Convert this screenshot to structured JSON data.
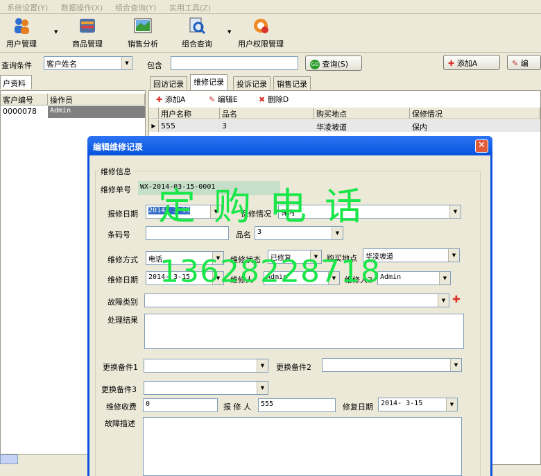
{
  "menubar": {
    "items": [
      "系统设置(Y)",
      "数据操作(X)",
      "组合查询(Y)",
      "实用工具(Z)"
    ]
  },
  "toolbar": {
    "buttons": [
      {
        "label": "用户管理",
        "icon": "users-icon"
      },
      {
        "label": "商品管理",
        "icon": "goods-icon"
      },
      {
        "label": "销售分析",
        "icon": "chart-icon"
      },
      {
        "label": "组合查询",
        "icon": "query-icon"
      },
      {
        "label": "用户权限管理",
        "icon": "permission-icon"
      }
    ]
  },
  "query": {
    "condition_label": "查询条件",
    "condition_value": "客户姓名",
    "contains_label": "包含",
    "contains_value": "",
    "search_button": "查询(S)",
    "add_button": "添加A",
    "edit_button": "编"
  },
  "left_panel": {
    "tab": "户资料",
    "columns": [
      "客户编号",
      "操作员"
    ],
    "rows": [
      [
        "0000078",
        "Admin"
      ]
    ]
  },
  "tabs": [
    "回访记录",
    "维修记录",
    "投诉记录",
    "销售记录"
  ],
  "sub_toolbar": {
    "add": "添加A",
    "edit": "编辑E",
    "delete": "删除D"
  },
  "repair_grid": {
    "columns": [
      "用户名称",
      "品名",
      "购买地点",
      "保修情况"
    ],
    "rows": [
      [
        "555",
        "3",
        "华凌坡道",
        "保内"
      ]
    ]
  },
  "dialog": {
    "title": "编辑维修记录",
    "group_title": "维修信息",
    "fields": {
      "order_no_label": "维修单号",
      "order_no": "WX-2014-03-15-0001",
      "report_date_label": "报修日期",
      "report_date": "2014- 3-15",
      "warranty_label": "保修情况",
      "warranty": "保内",
      "barcode_label": "条码号",
      "barcode": "",
      "product_label": "品名",
      "product": "3",
      "repair_mode_label": "维修方式",
      "repair_mode": "电话",
      "repair_status_label": "维修状态",
      "repair_status": "已修复",
      "purchase_place_label": "购买地点",
      "purchase_place": "华凌坡道",
      "repair_date_label": "维修日期",
      "repair_date": "2014- 3-15",
      "repairer_label": "维修人",
      "repairer": "Admin",
      "repairer2_label": "维修人2",
      "repairer2": "Admin",
      "fault_type_label": "故障类别",
      "fault_type": "",
      "result_label": "处理结果",
      "result": "",
      "part1_label": "更换备件1",
      "part1": "",
      "part2_label": "更换备件2",
      "part2": "",
      "part3_label": "更换备件3",
      "part3": "",
      "fee_label": "维修收费",
      "fee": "0",
      "reporter_label": "报 修 人",
      "reporter": "555",
      "fix_date_label": "修复日期",
      "fix_date": "2014- 3-15",
      "fault_desc_label": "故障描述",
      "fault_desc": ""
    }
  },
  "watermark": {
    "line1": "定购电话",
    "line2": "13628228718"
  },
  "colors": {
    "dialog_title": "#0753dc",
    "watermark": "#19e648",
    "xp_face": "#ece9d8",
    "selection": "#316ac5"
  }
}
